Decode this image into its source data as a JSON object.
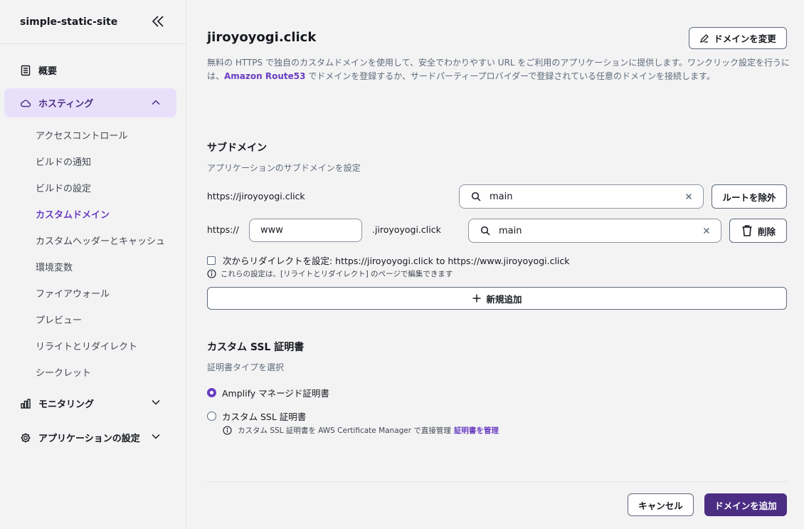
{
  "sidebar": {
    "app_name": "simple-static-site",
    "overview": "概要",
    "hosting": "ホスティング",
    "hosting_items": [
      "アクセスコントロール",
      "ビルドの通知",
      "ビルドの設定",
      "カスタムドメイン",
      "カスタムヘッダーとキャッシュ",
      "環境変数",
      "ファイアウォール",
      "プレビュー",
      "リライトとリダイレクト",
      "シークレット"
    ],
    "monitoring": "モニタリング",
    "app_settings": "アプリケーションの設定"
  },
  "main": {
    "domain": "jiroyoyogi.click",
    "change_domain_button": "ドメインを変更",
    "description_1": "無料の HTTPS で独自のカスタムドメインを使用して、安全でわかりやすい URL をご利用のアプリケーションに提供します。ワンクリック設定を行うには、",
    "description_link": "Amazon Route53",
    "description_2": " でドメインを登録するか、サードパーティープロバイダーで登録されている任意のドメインを接続します。",
    "subdomain": {
      "heading": "サブドメイン",
      "subtitle": "アプリケーションのサブドメインを設定",
      "root_url": "https://jiroyoyogi.click",
      "root_branch": "main",
      "exclude_root_button": "ルートを除外",
      "prefix": "https://",
      "sub_value": "www",
      "suffix": ".jiroyoyogi.click",
      "sub_branch": "main",
      "delete_button": "削除",
      "redirect_label": "次からリダイレクトを設定: https://jiroyoyogi.click to https://www.jiroyoyogi.click",
      "info_text": "これらの設定は、[リライトとリダイレクト] のページで編集できます",
      "add_button": "新規追加"
    },
    "ssl": {
      "heading": "カスタム SSL 証明書",
      "subtitle": "証明書タイプを選択",
      "option_managed": "Amplify マネージド証明書",
      "option_custom": "カスタム SSL 証明書",
      "custom_info": "カスタム SSL 証明書を AWS Certificate Manager で直接管理",
      "custom_info_link": "証明書を管理",
      "selected": "Amplify マネージド証明書"
    },
    "footer": {
      "cancel_button": "キャンセル",
      "add_domain_button": "ドメインを追加"
    }
  },
  "colors": {
    "accent": "#6a3ec2",
    "primary_button": "#4b2e83",
    "active_bg": "#e8e0fb"
  },
  "icons": [
    "collapse-icon",
    "document-icon",
    "cloud-icon",
    "chevron-up-icon",
    "chart-icon",
    "chevron-down-icon",
    "settings-icon",
    "edit-icon",
    "search-icon",
    "clear-icon",
    "trash-icon",
    "info-icon",
    "plus-icon"
  ]
}
